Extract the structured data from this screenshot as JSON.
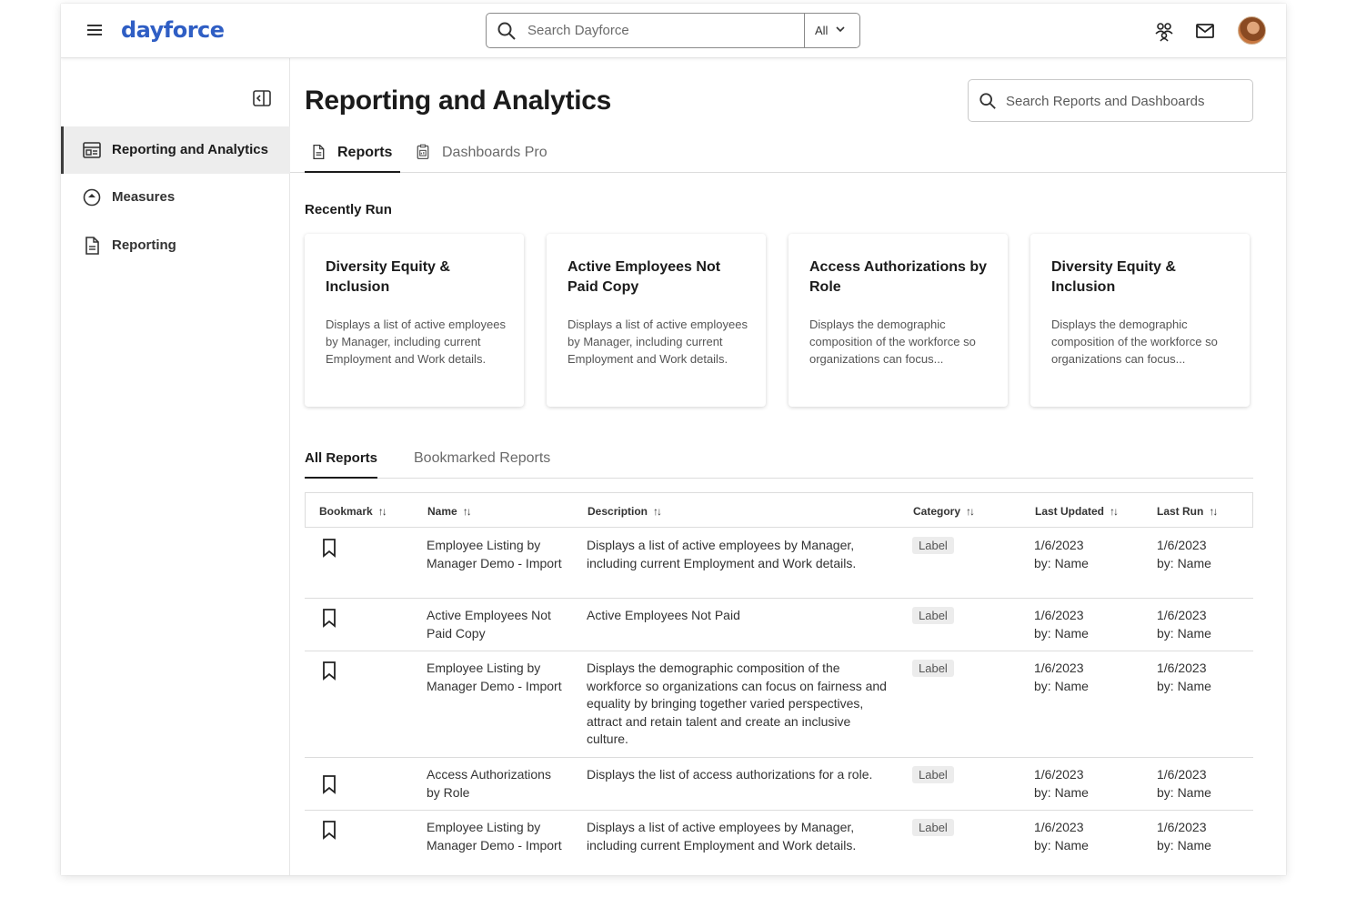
{
  "topbar": {
    "logo": "dayforce",
    "search_placeholder": "Search Dayforce",
    "search_scope": "All"
  },
  "sidebar": {
    "items": [
      {
        "label": "Reporting and Analytics",
        "icon": "dashboard-icon",
        "active": true
      },
      {
        "label": "Measures",
        "icon": "measures-icon",
        "active": false
      },
      {
        "label": "Reporting",
        "icon": "document-icon",
        "active": false
      }
    ]
  },
  "main": {
    "title": "Reporting and Analytics",
    "search_placeholder": "Search Reports and Dashboards",
    "tabs": [
      {
        "label": "Reports",
        "active": true
      },
      {
        "label": "Dashboards Pro",
        "active": false
      }
    ],
    "recently_run_label": "Recently Run",
    "cards": [
      {
        "title": "Diversity Equity & Inclusion",
        "description": "Displays a list of active employees by Manager, including current Employment and Work details."
      },
      {
        "title": "Active Employees Not Paid Copy",
        "description": "Displays a list of active employees by Manager, including current Employment and Work details."
      },
      {
        "title": "Access Authorizations by Role",
        "description": "Displays the demographic composition of the workforce so organizations can focus..."
      },
      {
        "title": "Diversity Equity & Inclusion",
        "description": "Displays the demographic composition of the workforce so organizations can focus..."
      }
    ],
    "subtabs": [
      {
        "label": "All Reports",
        "active": true
      },
      {
        "label": "Bookmarked Reports",
        "active": false
      }
    ],
    "table": {
      "sort_glyph": "↑↓",
      "columns": [
        "Bookmark",
        "Name",
        "Description",
        "Category",
        "Last Updated",
        "Last Run"
      ],
      "rows": [
        {
          "name": "Employee Listing by Manager Demo - Import",
          "description": "Displays a list of active employees by Manager, including current Employment and Work details.",
          "category": "Label",
          "updated_date": "1/6/2023",
          "updated_by": "by: Name",
          "run_date": "1/6/2023",
          "run_by": "by: Name"
        },
        {
          "name": "Active Employees Not Paid Copy",
          "description": "Active Employees Not Paid",
          "category": "Label",
          "updated_date": "1/6/2023",
          "updated_by": "by: Name",
          "run_date": "1/6/2023",
          "run_by": "by: Name"
        },
        {
          "name": "Employee Listing by Manager Demo - Import",
          "description": "Displays the demographic composition of the workforce so organizations can focus on fairness and equality by bringing together varied perspectives, attract and retain talent and create an inclusive culture.",
          "category": "Label",
          "updated_date": "1/6/2023",
          "updated_by": "by: Name",
          "run_date": "1/6/2023",
          "run_by": "by: Name"
        },
        {
          "name": "Access Authorizations by Role",
          "description": "Displays the list of access authorizations for a role.",
          "category": "Label",
          "updated_date": "1/6/2023",
          "updated_by": "by: Name",
          "run_date": "1/6/2023",
          "run_by": "by: Name"
        },
        {
          "name": "Employee Listing by Manager Demo - Import",
          "description": "Displays a list of active employees by Manager, including current Employment and Work details.",
          "category": "Label",
          "updated_date": "1/6/2023",
          "updated_by": "by: Name",
          "run_date": "1/6/2023",
          "run_by": "by: Name"
        }
      ]
    }
  },
  "colors": {
    "brand": "#2f5ec4",
    "active_bg": "#ededed",
    "border": "#dcdcdc"
  }
}
